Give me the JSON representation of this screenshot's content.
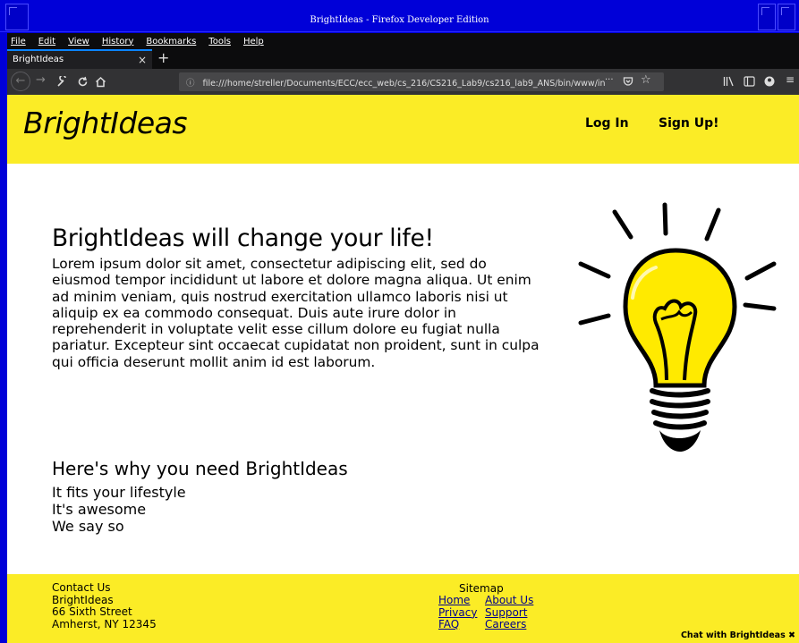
{
  "window": {
    "title": "BrightIdeas - Firefox Developer Edition"
  },
  "menu": [
    "File",
    "Edit",
    "View",
    "History",
    "Bookmarks",
    "Tools",
    "Help"
  ],
  "tab": {
    "label": "BrightIdeas",
    "close": "×",
    "new": "+"
  },
  "url": {
    "info_icon": "ⓘ",
    "text": "file:///home/streller/Documents/ECC/ecc_web/cs_216/CS216_Lab9/cs216_lab9_ANS/bin/www/in"
  },
  "site": {
    "logo": "BrightIdeas",
    "nav": {
      "login": "Log In",
      "signup": "Sign Up!"
    },
    "hero": {
      "title": "BrightIdeas will change your life!",
      "text": "Lorem ipsum dolor sit amet, consectetur adipiscing elit, sed do eiusmod tempor incididunt ut labore et dolore magna aliqua. Ut enim ad minim veniam, quis nostrud exercitation ullamco laboris nisi ut aliquip ex ea commodo consequat. Duis aute irure dolor in reprehenderit in voluptate velit esse cillum dolore eu fugiat nulla pariatur. Excepteur sint occaecat cupidatat non proident, sunt in culpa qui officia deserunt mollit anim id est laborum."
    },
    "why": {
      "title": "Here's why you need BrightIdeas",
      "items": [
        "It fits your lifestyle",
        "It's awesome",
        "We say so"
      ]
    },
    "footer": {
      "contact": [
        "Contact Us",
        "BrightIdeas",
        "66 Sixth Street",
        "Amherst, NY 12345"
      ],
      "sitemap_title": "Sitemap",
      "links": [
        "Home",
        "About Us",
        "Privacy",
        "Support",
        "FAQ",
        "Careers"
      ]
    },
    "chat": "Chat with BrightIdeas  ✖"
  },
  "colors": {
    "header": "#fbec26",
    "titlebar": "#0000d8",
    "link": "#00008b"
  }
}
